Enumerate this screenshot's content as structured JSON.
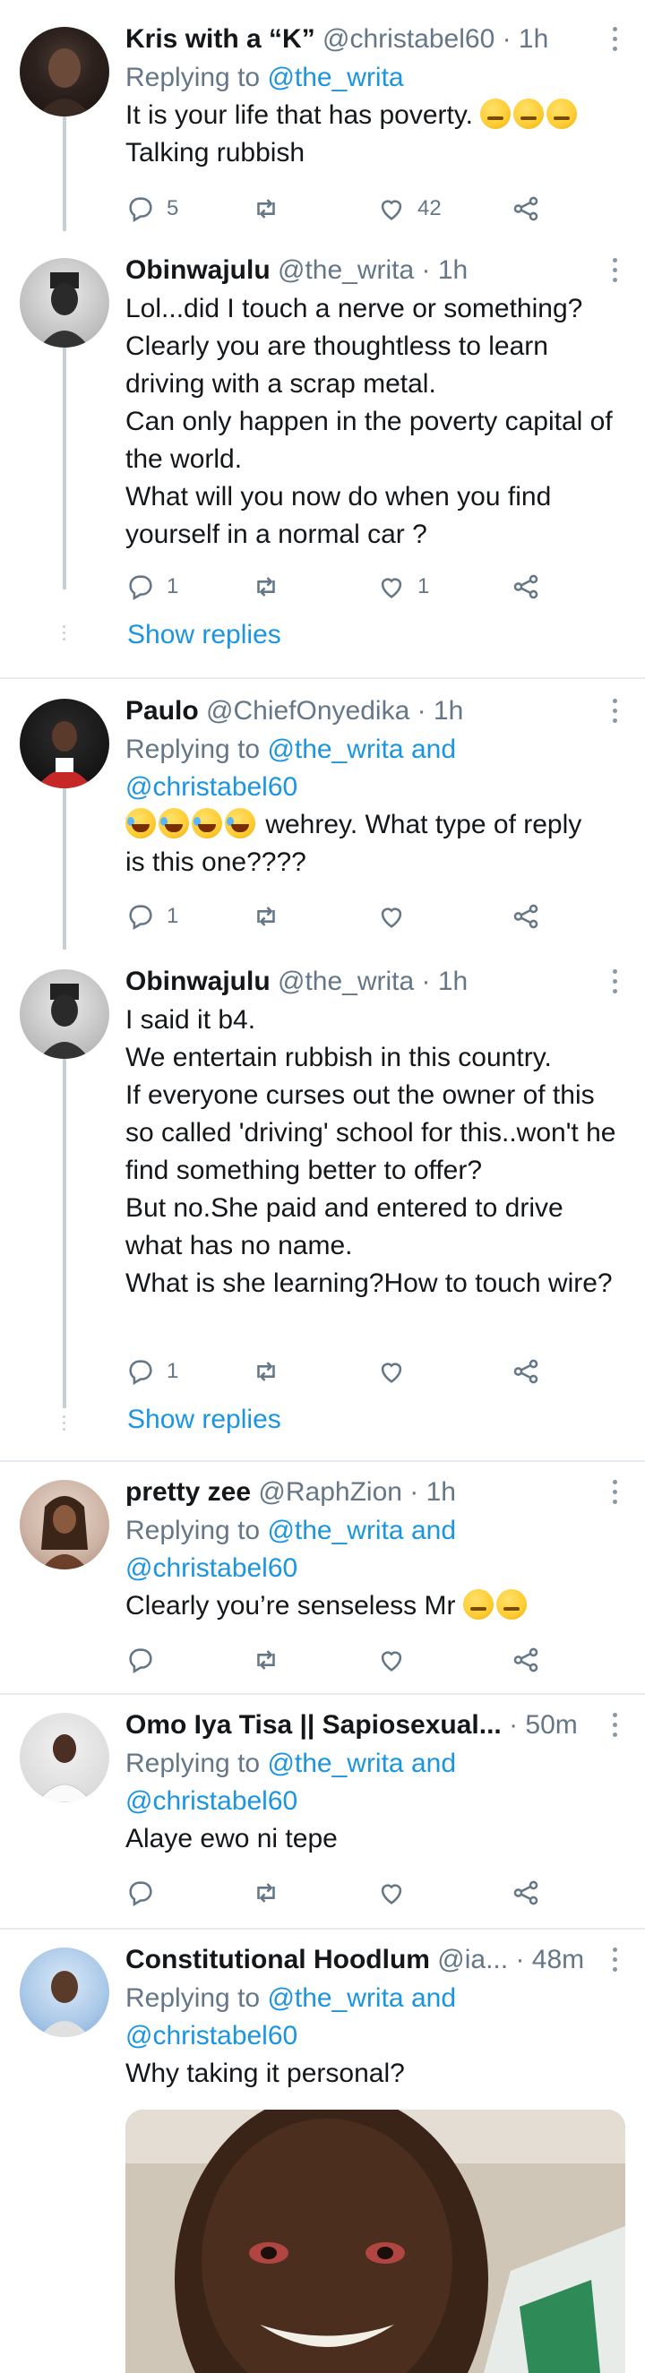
{
  "tweets": [
    {
      "name": "Kris with a “K”",
      "handle": "@christabel60",
      "time": "· 1h",
      "replying_prefix": "Replying to ",
      "replying_to": "@the_writa",
      "text": "It is your life that has poverty.",
      "text_line2": "Talking rubbish",
      "emojis": [
        "smirk-face",
        "smirk-face",
        "smirk-face"
      ],
      "replies": "5",
      "retweets": "",
      "likes": "42"
    },
    {
      "name": "Obinwajulu",
      "handle": "@the_writa",
      "time": "· 1h",
      "text": "Lol...did I touch a nerve or something?\nClearly you are thoughtless to learn driving with a scrap metal.\nCan only happen in the poverty capital of the world.\nWhat will you now do when you find yourself in a normal car ?",
      "replies": "1",
      "retweets": "",
      "likes": "1",
      "show_replies": "Show replies"
    },
    {
      "name": "Paulo",
      "handle": "@ChiefOnyedika",
      "time": "· 1h",
      "replying_prefix": "Replying to ",
      "replying_to": "@the_writa and",
      "replying_to_2": "@christabel60",
      "emojis": [
        "laughing-face",
        "laughing-face",
        "laughing-face",
        "laughing-face"
      ],
      "text": " wehrey. What type of reply",
      "text_line2": "is this one????",
      "replies": "1",
      "retweets": "",
      "likes": ""
    },
    {
      "name": "Obinwajulu",
      "handle": "@the_writa",
      "time": "· 1h",
      "text": "I said it b4.\nWe entertain rubbish in this country.\nIf everyone curses out the owner of this so called 'driving' school for this..won't he find something better to offer?\nBut no.She paid and entered to drive what has no name.\nWhat is she learning?How to touch wire?",
      "replies": "1",
      "retweets": "",
      "likes": "",
      "show_replies": "Show replies"
    },
    {
      "name": "pretty zee",
      "handle": "@RaphZion",
      "time": "· 1h",
      "replying_prefix": "Replying to ",
      "replying_to": "@the_writa and",
      "replying_to_2": "@christabel60",
      "text": "Clearly you’re senseless Mr",
      "emojis": [
        "smirk-face",
        "smirk-face"
      ],
      "replies": "",
      "retweets": "",
      "likes": ""
    },
    {
      "name": "Omo Iya Tisa || Sapiosexual...",
      "handle": "",
      "time": "· 50m",
      "replying_prefix": "Replying to ",
      "replying_to": "@the_writa and",
      "replying_to_2": "@christabel60",
      "text": "Alaye ewo ni tepe",
      "replies": "",
      "retweets": "",
      "likes": ""
    },
    {
      "name": "Constitutional Hoodlum",
      "handle": "@ia...",
      "time": "· 48m",
      "replying_prefix": "Replying to ",
      "replying_to": "@the_writa and",
      "replying_to_2": "@christabel60",
      "text": "Why taking it personal?",
      "media": "photo-child-smiling"
    }
  ],
  "icons": {
    "reply": "reply-icon",
    "retweet": "retweet-icon",
    "like": "heart-icon",
    "share": "share-icon",
    "more": "more-dots-icon"
  },
  "colors": {
    "link": "#1b95e0",
    "secondary_text": "#657786",
    "divider": "#e6ecf0",
    "thread_line": "#c4cfd6"
  }
}
